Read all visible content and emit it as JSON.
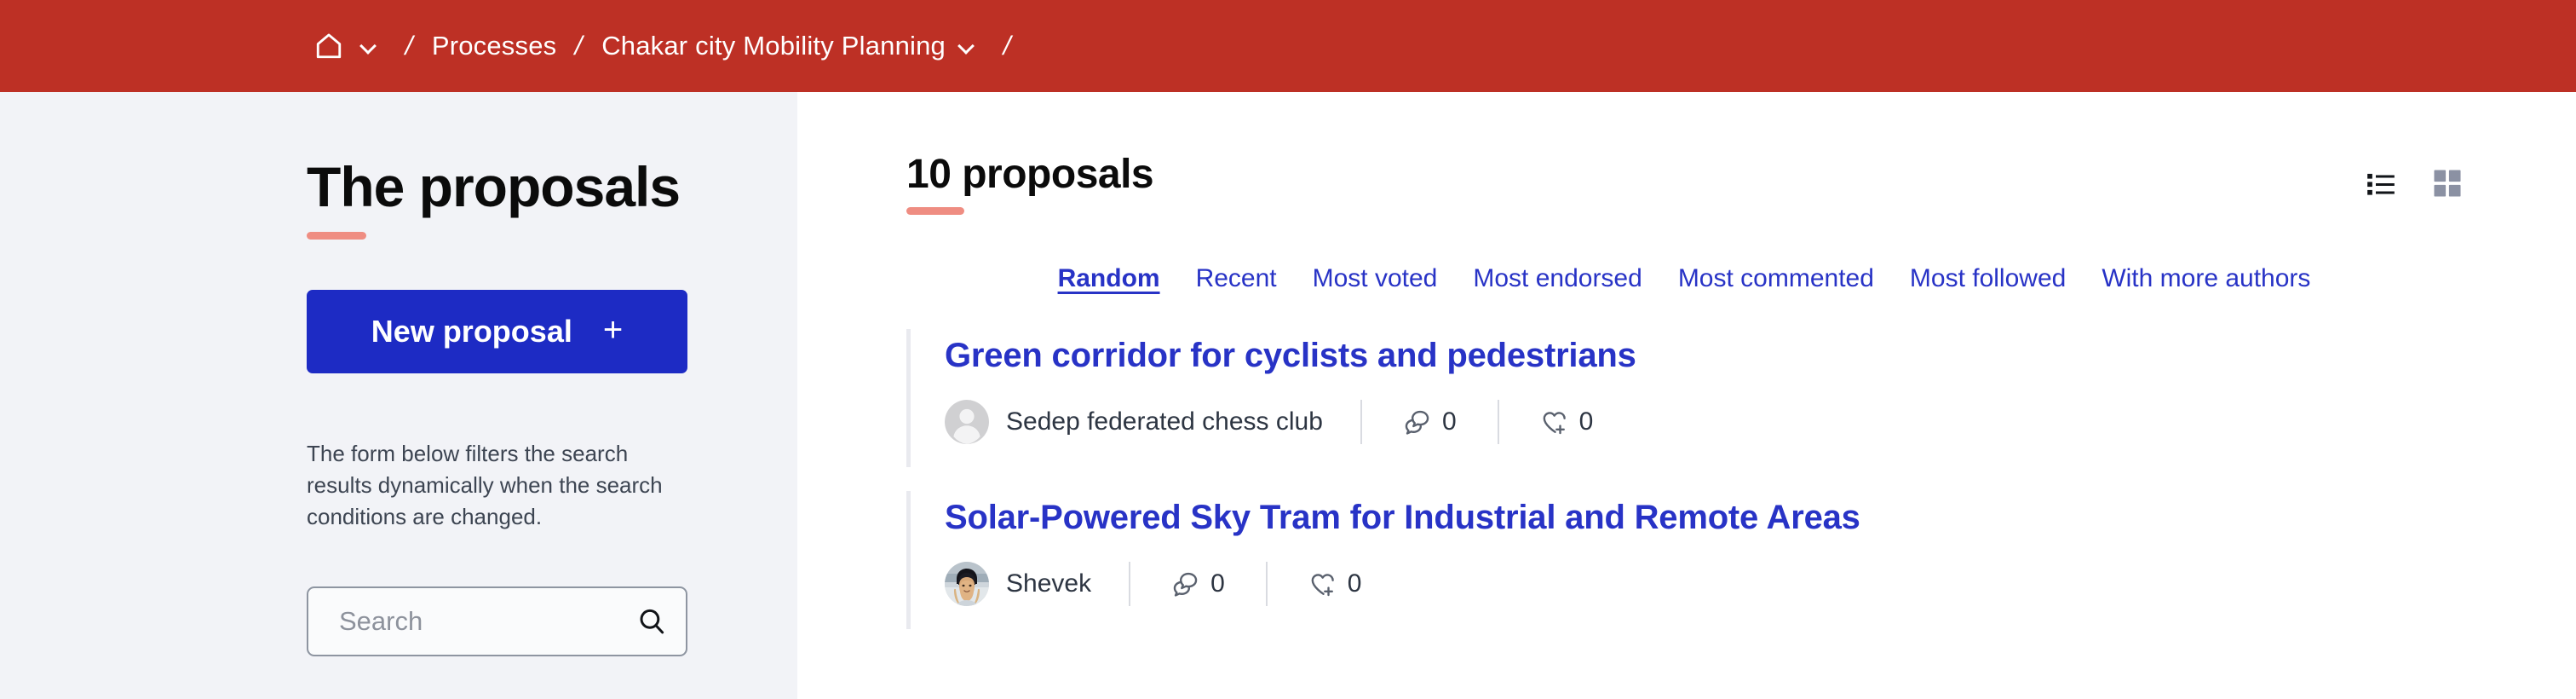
{
  "breadcrumb": {
    "home_icon": "home-icon",
    "home_caret_icon": "chevron-down-icon",
    "separator": "/",
    "items": [
      {
        "label": "Processes",
        "has_caret": false
      },
      {
        "label": "Chakar city Mobility Planning",
        "has_caret": true
      }
    ],
    "bar_color": "#bd3025"
  },
  "sidebar": {
    "title": "The proposals",
    "new_proposal_label": "New proposal",
    "new_proposal_plus": "+",
    "new_proposal_color": "#1d2bc4",
    "accent_rule_color": "#ef8d82",
    "filter_note": "The form below filters the search results dynamically when the search conditions are changed.",
    "search": {
      "placeholder": "Search",
      "value": "",
      "icon": "search-icon"
    }
  },
  "main": {
    "count_title": "10 proposals",
    "view_modes": [
      {
        "name": "list",
        "icon": "list-view-icon",
        "active": true
      },
      {
        "name": "grid",
        "icon": "grid-view-icon",
        "active": false
      }
    ],
    "order_tabs": [
      {
        "label": "Random",
        "active": true
      },
      {
        "label": "Recent",
        "active": false
      },
      {
        "label": "Most voted",
        "active": false
      },
      {
        "label": "Most endorsed",
        "active": false
      },
      {
        "label": "Most commented",
        "active": false
      },
      {
        "label": "Most followed",
        "active": false
      },
      {
        "label": "With more authors",
        "active": false
      }
    ],
    "link_color": "#2833c6",
    "proposals": [
      {
        "title": "Green corridor for cyclists and pedestrians",
        "author": "Sedep federated chess club",
        "avatar_type": "placeholder",
        "comments_icon": "comment-icon",
        "comments": "0",
        "endorsements_icon": "endorse-heart-icon",
        "endorsements": "0"
      },
      {
        "title": "Solar-Powered Sky Tram for Industrial and Remote Areas",
        "author": "Shevek",
        "avatar_type": "photo",
        "comments_icon": "comment-icon",
        "comments": "0",
        "endorsements_icon": "endorse-heart-icon",
        "endorsements": "0"
      }
    ]
  }
}
